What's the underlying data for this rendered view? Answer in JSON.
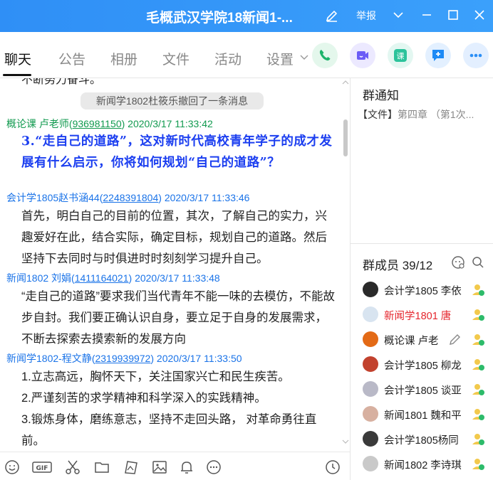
{
  "window": {
    "title": "毛概武汉学院18新闻1-...",
    "report_label": "举报"
  },
  "tabs": [
    "聊天",
    "公告",
    "相册",
    "文件",
    "活动",
    "设置"
  ],
  "colors": {
    "title_bar": "#3ba0fb",
    "call_green": "#1db36b",
    "video_purple": "#6b5cf6",
    "course_green": "#2cc39b",
    "add_blue": "#1d8af5",
    "more_blue": "#2b8ef5",
    "link_blue": "#1a73e8",
    "host_green": "#119a4f",
    "question_blue": "#1b3ef0",
    "red_name": "#e5262d"
  },
  "chat": {
    "top_partial_text": "不断努力奋斗。",
    "system_notice": "新闻学1802杜筱乐撤回了一条消息",
    "messages": [
      {
        "name": "概论课  卢老师",
        "uid": "936981150",
        "time": "2020/3/17 11:33:42",
        "text": "3.“走自己的道路”，这对新时代高校青年学子的成才发展有什么启示，你将如何规划“自己的道路”？"
      },
      {
        "name": "会计学1805赵书涵44",
        "uid": "2248391804",
        "time": "2020/3/17 11:33:46",
        "text": "首先，明白自己的目前的位置，其次，了解自己的实力，兴趣爱好在此，结合实际，确定目标，规划自己的道路。然后坚持下去同时与时俱进时时刻刻学习提升自己。"
      },
      {
        "name": "新闻1802 刘娟",
        "uid": "1411164021",
        "time": "2020/3/17 11:33:48",
        "text": "“走自己的道路”要求我们当代青年不能一味的去模仿，不能故步自封。我们要正确认识自身，要立足于自身的发展需求，不断去探索去摸索新的发展方向"
      },
      {
        "name": "新闻学1802-程文静",
        "uid": "2319939972",
        "time": "2020/3/17 11:33:50",
        "lines": [
          "1.立志高远，胸怀天下，关注国家兴亡和民生疾苦。",
          "2.严谨刻苦的求学精神和科学深入的实践精神。",
          "3.锻炼身体，磨练意志，坚持不走回头路， 对革命勇往直前。"
        ]
      }
    ]
  },
  "side": {
    "notice_title": "群通知",
    "notice_tag": "【文件】",
    "notice_text": "第四章 （第1次...",
    "members_title": "群成员 39/12",
    "members": [
      {
        "name": "会计学1805 李依",
        "red": false,
        "badge": "host",
        "avatar": "#2a2a2a"
      },
      {
        "name": "新闻学1801  唐",
        "red": true,
        "badge": "host",
        "avatar": "#d8e4f0"
      },
      {
        "name": "概论课  卢老",
        "red": false,
        "badge": "owner",
        "avatar": "#e36a16"
      },
      {
        "name": "会计学1805 柳龙",
        "red": false,
        "badge": "host",
        "avatar": "#c2422e"
      },
      {
        "name": "会计学1805 谈亚",
        "red": false,
        "badge": "host",
        "avatar": "#b9b9c7"
      },
      {
        "name": "新闻1801 魏和平",
        "red": false,
        "badge": "host",
        "avatar": "#d7b0a0"
      },
      {
        "name": "会计学1805杨同",
        "red": false,
        "badge": "host",
        "avatar": "#3a3a3a"
      },
      {
        "name": "新闻1802 李诗琪",
        "red": false,
        "badge": "host",
        "avatar": "#c9c9c9"
      }
    ]
  }
}
